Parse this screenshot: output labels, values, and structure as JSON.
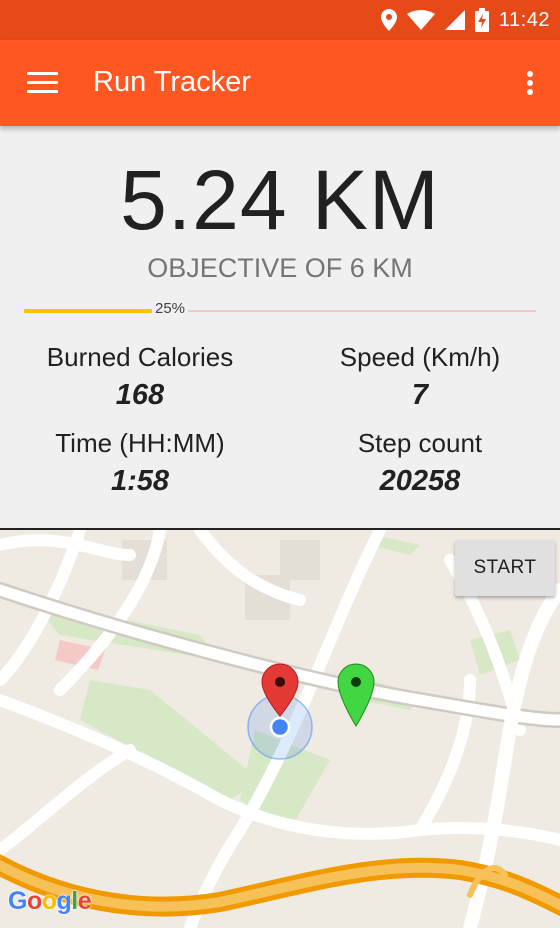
{
  "status_bar": {
    "time": "11:42",
    "icons": [
      "location-icon",
      "wifi-icon",
      "cell-signal-icon",
      "battery-charging-icon"
    ]
  },
  "toolbar": {
    "title": "Run Tracker",
    "menu_icon": "hamburger-menu-icon",
    "overflow_icon": "more-vert-icon",
    "background": "#ff5722"
  },
  "stats": {
    "distance": "5.24 KM",
    "objective": "OBJECTIVE OF 6 KM",
    "progress_label": "25%",
    "progress_fraction": 0.25,
    "progress_color": "#ffc107",
    "items": [
      {
        "label": "Burned Calories",
        "value": "168"
      },
      {
        "label": "Speed (Km/h)",
        "value": "7"
      },
      {
        "label": "Time (HH:MM)",
        "value": "1:58"
      },
      {
        "label": "Step count",
        "value": "20258"
      }
    ]
  },
  "map": {
    "start_button": "START",
    "attribution": "Google",
    "markers": [
      {
        "name": "red-marker",
        "color": "#e53935"
      },
      {
        "name": "green-marker",
        "color": "#43d643"
      }
    ],
    "location_dot_color": "#4285f4"
  }
}
